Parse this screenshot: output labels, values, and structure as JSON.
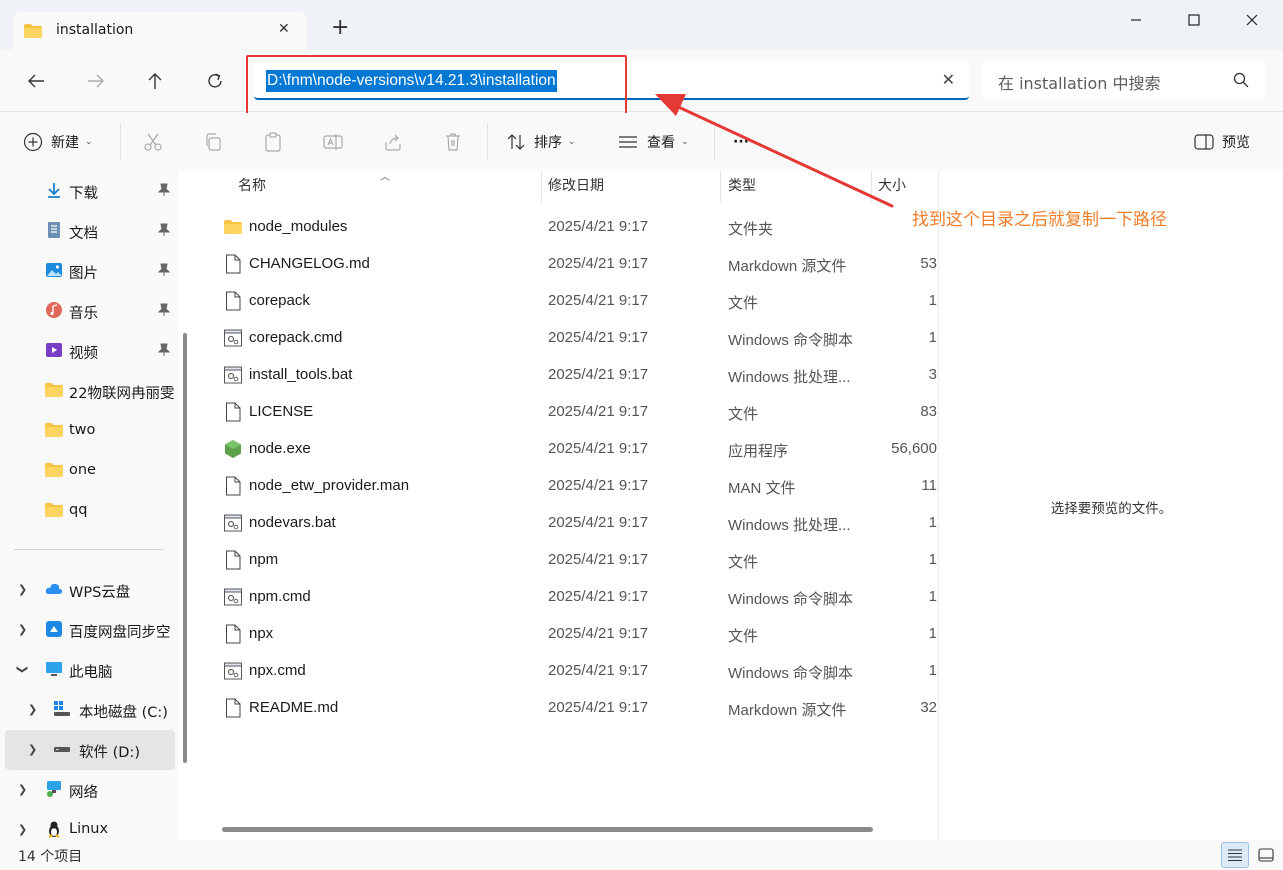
{
  "window": {
    "tab_title": "installation",
    "new_tab": "+",
    "colors": {
      "accent": "#0078d4",
      "annotation": "#ef7d2a",
      "highlight_box": "#e53935",
      "folder": "#f6c343",
      "node_green": "#5fa04e"
    }
  },
  "address_bar": {
    "path": "D:\\fnm\\node-versions\\v14.21.3\\installation",
    "search_placeholder": "在 installation 中搜索"
  },
  "command_bar": {
    "new_label": "新建",
    "sort_label": "排序",
    "view_label": "查看",
    "more": "···",
    "preview_label": "预览"
  },
  "sidebar": {
    "quick_access": [
      {
        "label": "下载",
        "icon": "download-icon",
        "pinned": true
      },
      {
        "label": "文档",
        "icon": "document-icon",
        "pinned": true
      },
      {
        "label": "图片",
        "icon": "pictures-icon",
        "pinned": true
      },
      {
        "label": "音乐",
        "icon": "music-icon",
        "pinned": true
      },
      {
        "label": "视频",
        "icon": "video-icon",
        "pinned": true
      },
      {
        "label": "22物联网冉丽雯",
        "icon": "folder-icon",
        "pinned": false
      },
      {
        "label": "two",
        "icon": "folder-icon",
        "pinned": false
      },
      {
        "label": "one",
        "icon": "folder-icon",
        "pinned": false
      },
      {
        "label": "qq",
        "icon": "folder-icon",
        "pinned": false
      }
    ],
    "tree": [
      {
        "label": "WPS云盘",
        "icon": "cloud-icon",
        "expanded": false
      },
      {
        "label": "百度网盘同步空",
        "icon": "baidu-netdisk-icon",
        "expanded": false
      },
      {
        "label": "此电脑",
        "icon": "this-pc-icon",
        "expanded": true
      },
      {
        "label": "本地磁盘 (C:)",
        "icon": "windows-drive-icon",
        "expanded": false
      },
      {
        "label": "软件 (D:)",
        "icon": "drive-icon",
        "expanded": false,
        "selected": true
      },
      {
        "label": "网络",
        "icon": "network-icon",
        "expanded": false
      },
      {
        "label": "Linux",
        "icon": "linux-icon",
        "expanded": false
      }
    ]
  },
  "file_list": {
    "columns": {
      "name": "名称",
      "date": "修改日期",
      "type": "类型",
      "size": "大小"
    },
    "files": [
      {
        "name": "node_modules",
        "date": "2025/4/21 9:17",
        "type": "文件夹",
        "size": "",
        "icon": "folder-icon"
      },
      {
        "name": "CHANGELOG.md",
        "date": "2025/4/21 9:17",
        "type": "Markdown 源文件",
        "size": "53",
        "icon": "file-icon"
      },
      {
        "name": "corepack",
        "date": "2025/4/21 9:17",
        "type": "文件",
        "size": "1",
        "icon": "file-icon"
      },
      {
        "name": "corepack.cmd",
        "date": "2025/4/21 9:17",
        "type": "Windows 命令脚本",
        "size": "1",
        "icon": "script-icon"
      },
      {
        "name": "install_tools.bat",
        "date": "2025/4/21 9:17",
        "type": "Windows 批处理...",
        "size": "3",
        "icon": "script-icon"
      },
      {
        "name": "LICENSE",
        "date": "2025/4/21 9:17",
        "type": "文件",
        "size": "83",
        "icon": "file-icon"
      },
      {
        "name": "node.exe",
        "date": "2025/4/21 9:17",
        "type": "应用程序",
        "size": "56,600",
        "icon": "nodejs-icon"
      },
      {
        "name": "node_etw_provider.man",
        "date": "2025/4/21 9:17",
        "type": "MAN 文件",
        "size": "11",
        "icon": "file-icon"
      },
      {
        "name": "nodevars.bat",
        "date": "2025/4/21 9:17",
        "type": "Windows 批处理...",
        "size": "1",
        "icon": "script-icon"
      },
      {
        "name": "npm",
        "date": "2025/4/21 9:17",
        "type": "文件",
        "size": "1",
        "icon": "file-icon"
      },
      {
        "name": "npm.cmd",
        "date": "2025/4/21 9:17",
        "type": "Windows 命令脚本",
        "size": "1",
        "icon": "script-icon"
      },
      {
        "name": "npx",
        "date": "2025/4/21 9:17",
        "type": "文件",
        "size": "1",
        "icon": "file-icon"
      },
      {
        "name": "npx.cmd",
        "date": "2025/4/21 9:17",
        "type": "Windows 命令脚本",
        "size": "1",
        "icon": "script-icon"
      },
      {
        "name": "README.md",
        "date": "2025/4/21 9:17",
        "type": "Markdown 源文件",
        "size": "32",
        "icon": "file-icon"
      }
    ]
  },
  "preview_pane": {
    "message": "选择要预览的文件。"
  },
  "annotation": {
    "text": "找到这个目录之后就复制一下路径"
  },
  "status_bar": {
    "item_count": "14 个项目"
  }
}
